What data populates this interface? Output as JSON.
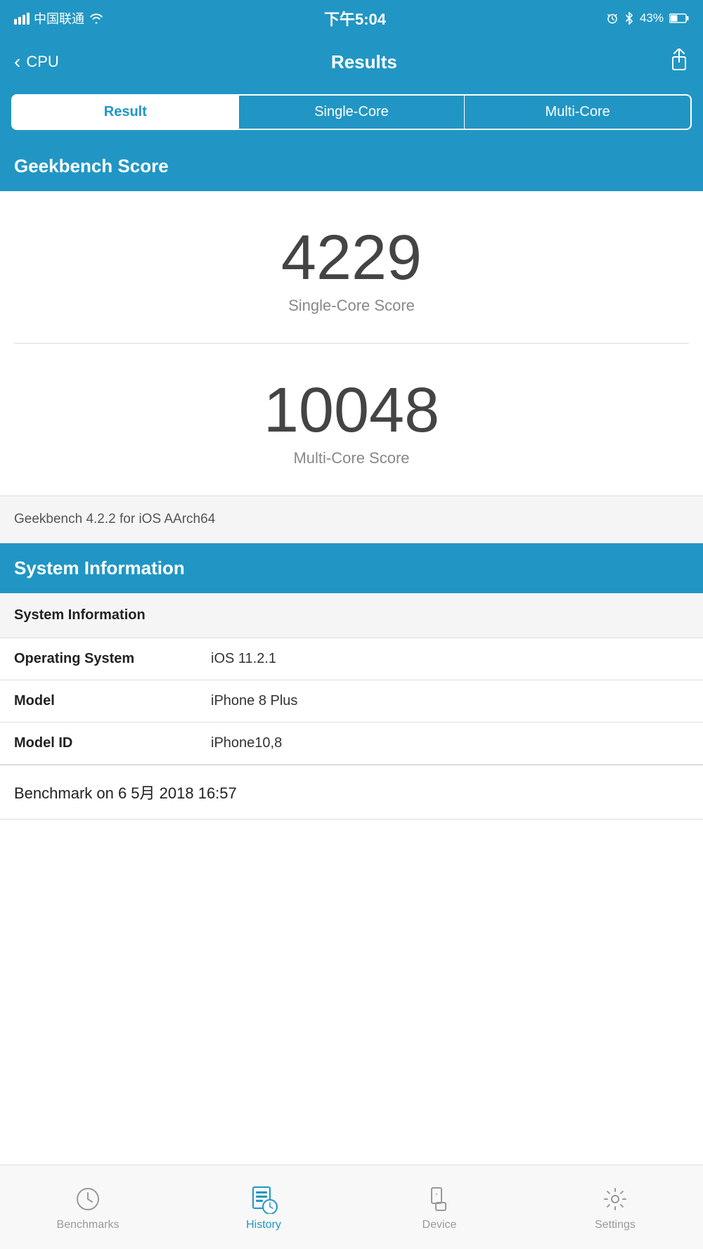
{
  "statusBar": {
    "carrier": "中国联通",
    "time": "下午5:04",
    "battery": "43%"
  },
  "navBar": {
    "backLabel": "CPU",
    "title": "Results",
    "shareIcon": "share-icon"
  },
  "tabs": [
    {
      "id": "result",
      "label": "Result",
      "active": true
    },
    {
      "id": "single-core",
      "label": "Single-Core",
      "active": false
    },
    {
      "id": "multi-core",
      "label": "Multi-Core",
      "active": false
    }
  ],
  "geekbenchScoreHeader": "Geekbench Score",
  "scores": {
    "singleCore": {
      "value": "4229",
      "label": "Single-Core Score"
    },
    "multiCore": {
      "value": "10048",
      "label": "Multi-Core Score"
    }
  },
  "geekbenchVersion": "Geekbench 4.2.2 for iOS AArch64",
  "systemInfoHeader": "System Information",
  "systemInfo": {
    "sectionLabel": "System Information",
    "rows": [
      {
        "label": "Operating System",
        "value": "iOS 11.2.1"
      },
      {
        "label": "Model",
        "value": "iPhone 8 Plus"
      },
      {
        "label": "Model ID",
        "value": "iPhone10,8"
      }
    ]
  },
  "benchmarkFooter": "Benchmark on 6 5月 2018 16:57",
  "bottomTabs": [
    {
      "id": "benchmarks",
      "label": "Benchmarks",
      "icon": "clock-icon",
      "active": false
    },
    {
      "id": "history",
      "label": "History",
      "icon": "history-icon",
      "active": true
    },
    {
      "id": "device",
      "label": "Device",
      "icon": "device-icon",
      "active": false
    },
    {
      "id": "settings",
      "label": "Settings",
      "icon": "settings-icon",
      "active": false
    }
  ]
}
